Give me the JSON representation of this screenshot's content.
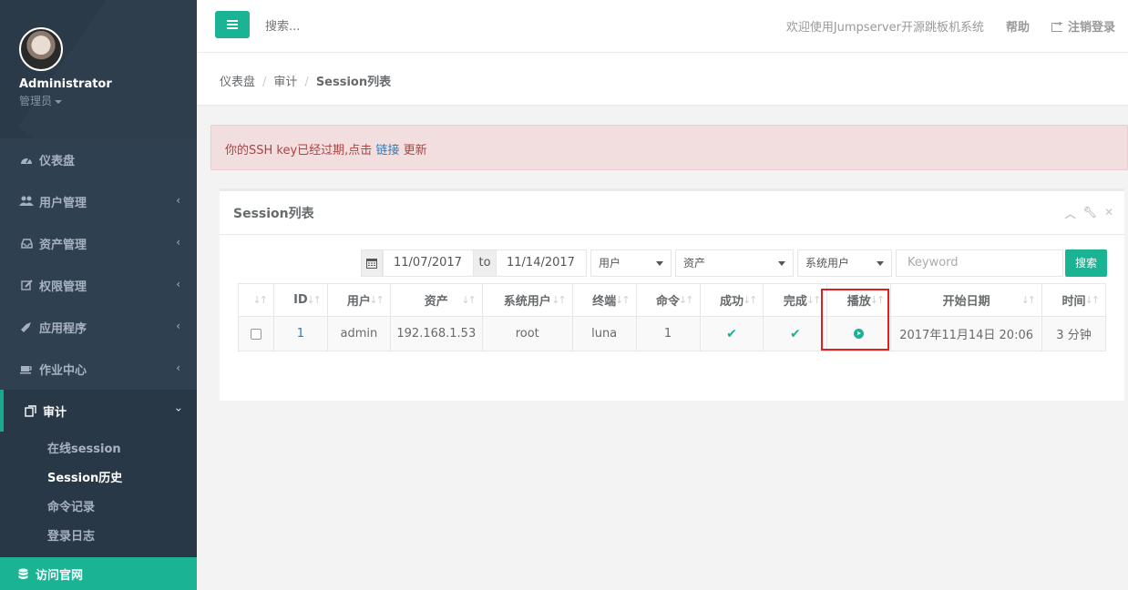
{
  "user": {
    "name": "Administrator",
    "role": "管理员"
  },
  "nav": {
    "items": [
      {
        "label": "仪表盘",
        "icon": "dashboard-icon",
        "has_children": false
      },
      {
        "label": "用户管理",
        "icon": "users-icon",
        "has_children": true
      },
      {
        "label": "资产管理",
        "icon": "inbox-icon",
        "has_children": true
      },
      {
        "label": "权限管理",
        "icon": "edit-icon",
        "has_children": true
      },
      {
        "label": "应用程序",
        "icon": "rocket-icon",
        "has_children": true
      },
      {
        "label": "作业中心",
        "icon": "coffee-icon",
        "has_children": true
      }
    ],
    "audit": {
      "label": "审计",
      "icon": "audit-icon",
      "expanded": true,
      "children": [
        "在线session",
        "Session历史",
        "命令记录",
        "登录日志"
      ],
      "current": "Session历史"
    },
    "visit": "访问官网"
  },
  "topbar": {
    "search_placeholder": "搜索...",
    "welcome": "欢迎使用Jumpserver开源跳板机系统",
    "help": "帮助",
    "logout": "注销登录"
  },
  "breadcrumb": {
    "home": "仪表盘",
    "parent": "审计",
    "current": "Session列表"
  },
  "alert": {
    "text": "你的SSH key已经过期,点击",
    "link": "链接",
    "suffix": "更新"
  },
  "panel": {
    "title": "Session列表",
    "filters": {
      "date_from": "11/07/2017",
      "to": "to",
      "date_to": "11/14/2017",
      "user": "用户",
      "asset": "资产",
      "system_user": "系统用户",
      "keyword_placeholder": "Keyword",
      "search": "搜索"
    },
    "columns": [
      "ID",
      "用户",
      "资产",
      "系统用户",
      "终端",
      "命令",
      "成功",
      "完成",
      "播放",
      "开始日期",
      "时间"
    ],
    "rows": [
      {
        "id": "1",
        "user": "admin",
        "asset": "192.168.1.53",
        "system_user": "root",
        "terminal": "luna",
        "commands": "1",
        "success": true,
        "finished": true,
        "start": "2017年11月14日 20:06",
        "duration": "3 分钟"
      }
    ]
  },
  "colors": {
    "sidebar": "#2f4050",
    "accent": "#1ab394",
    "alert_bg": "#f2dede",
    "alert_text": "#a94442",
    "highlight": "#e02020"
  }
}
